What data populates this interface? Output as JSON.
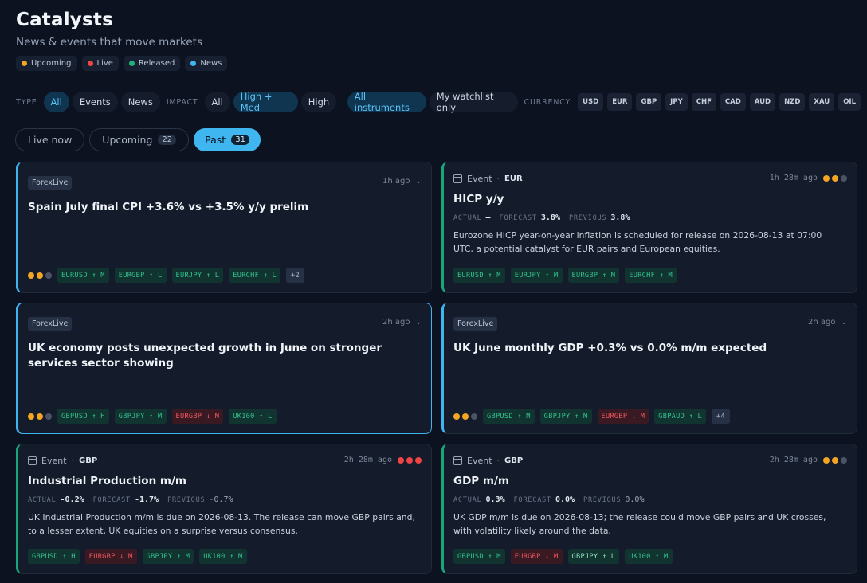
{
  "header": {
    "title": "Catalysts",
    "subtitle": "News & events that move markets",
    "legend": [
      {
        "label": "Upcoming",
        "color": "#f5a524"
      },
      {
        "label": "Live",
        "color": "#ef4444"
      },
      {
        "label": "Released",
        "color": "#22b07d"
      },
      {
        "label": "News",
        "color": "#3fb4ef"
      }
    ]
  },
  "filters": {
    "type_label": "TYPE",
    "type": [
      "All",
      "Events",
      "News"
    ],
    "impact_label": "IMPACT",
    "impact": [
      "All",
      "High + Med",
      "High"
    ],
    "instruments": [
      "All instruments",
      "My watchlist only"
    ],
    "currency_label": "CURRENCY",
    "currencies": [
      "USD",
      "EUR",
      "GBP",
      "JPY",
      "CHF",
      "CAD",
      "AUD",
      "NZD",
      "XAU",
      "OIL"
    ]
  },
  "tabs": [
    {
      "label": "Live now",
      "count": ""
    },
    {
      "label": "Upcoming",
      "count": "22"
    },
    {
      "label": "Past",
      "count": "31"
    }
  ],
  "cards": [
    {
      "source": "ForexLive",
      "time": "1h ago",
      "title": "Spain July final CPI +3.6% vs +3.5% y/y prelim",
      "tags": [
        {
          "label": "EURUSD ↑ M",
          "dir": "up"
        },
        {
          "label": "EURGBP ↑ L",
          "dir": "up"
        },
        {
          "label": "EURJPY ↑ L",
          "dir": "up"
        },
        {
          "label": "EURCHF ↑ L",
          "dir": "up"
        }
      ],
      "more": "+2"
    },
    {
      "kind": "Event",
      "currency": "EUR",
      "time": "1h 28m ago",
      "title": "HICP y/y",
      "actual_label": "ACTUAL",
      "actual": "—",
      "forecast_label": "FORECAST",
      "forecast": "3.8%",
      "previous_label": "PREVIOUS",
      "previous": "3.8%",
      "description": "Eurozone HICP year-on-year inflation is scheduled for release on 2026-08-13 at 07:00 UTC, a potential catalyst for EUR pairs and European equities.",
      "tags": [
        {
          "label": "EURUSD ↑ M",
          "dir": "up"
        },
        {
          "label": "EURJPY ↑ M",
          "dir": "up"
        },
        {
          "label": "EURGBP ↑ M",
          "dir": "up"
        },
        {
          "label": "EURCHF ↑ M",
          "dir": "up"
        }
      ]
    },
    {
      "source": "ForexLive",
      "time": "2h ago",
      "title": "UK economy posts unexpected growth in June on stronger services sector showing",
      "tags": [
        {
          "label": "GBPUSD ↑ H",
          "dir": "up"
        },
        {
          "label": "GBPJPY ↑ M",
          "dir": "up"
        },
        {
          "label": "EURGBP ↓ M",
          "dir": "down"
        },
        {
          "label": "UK100 ↑ L",
          "dir": "up"
        }
      ]
    },
    {
      "source": "ForexLive",
      "time": "2h ago",
      "title": "UK June monthly GDP +0.3% vs 0.0% m/m expected",
      "tags": [
        {
          "label": "GBPUSD ↑ M",
          "dir": "up"
        },
        {
          "label": "GBPJPY ↑ M",
          "dir": "up"
        },
        {
          "label": "EURGBP ↓ M",
          "dir": "down"
        },
        {
          "label": "GBPAUD ↑ L",
          "dir": "up"
        }
      ],
      "more": "+4"
    },
    {
      "kind": "Event",
      "currency": "GBP",
      "time": "2h 28m ago",
      "title": "Industrial Production m/m",
      "actual_label": "ACTUAL",
      "actual": "-0.2%",
      "forecast_label": "FORECAST",
      "forecast": "-1.7%",
      "previous_label": "PREVIOUS",
      "previous": "-0.7%",
      "description": "UK Industrial Production m/m is due on 2026-08-13. The release can move GBP pairs and, to a lesser extent, UK equities on a surprise versus consensus.",
      "tags": [
        {
          "label": "GBPUSD ↑ H",
          "dir": "up"
        },
        {
          "label": "EURGBP ↓ M",
          "dir": "down"
        },
        {
          "label": "GBPJPY ↑ M",
          "dir": "up"
        },
        {
          "label": "UK100 ↑ M",
          "dir": "up"
        }
      ]
    },
    {
      "kind": "Event",
      "currency": "GBP",
      "time": "2h 28m ago",
      "title": "GDP m/m",
      "actual_label": "ACTUAL",
      "actual": "0.3%",
      "forecast_label": "FORECAST",
      "forecast": "0.0%",
      "previous_label": "PREVIOUS",
      "previous": "0.0%",
      "description": "UK GDP m/m is due on 2026-08-13; the release could move GBP pairs and UK crosses, with volatility likely around the data.",
      "tags": [
        {
          "label": "GBPUSD ↑ M",
          "dir": "up"
        },
        {
          "label": "EURGBP ↓ M",
          "dir": "down"
        },
        {
          "label": "GBPJPY ↑ L",
          "dir": "up"
        },
        {
          "label": "UK100 ↑ M",
          "dir": "up"
        }
      ]
    }
  ],
  "colors": {
    "impact_high": "#ef4444",
    "impact_med": "#f5a524",
    "impact_off": "#4a5466",
    "accent": "#3fb4ef"
  }
}
